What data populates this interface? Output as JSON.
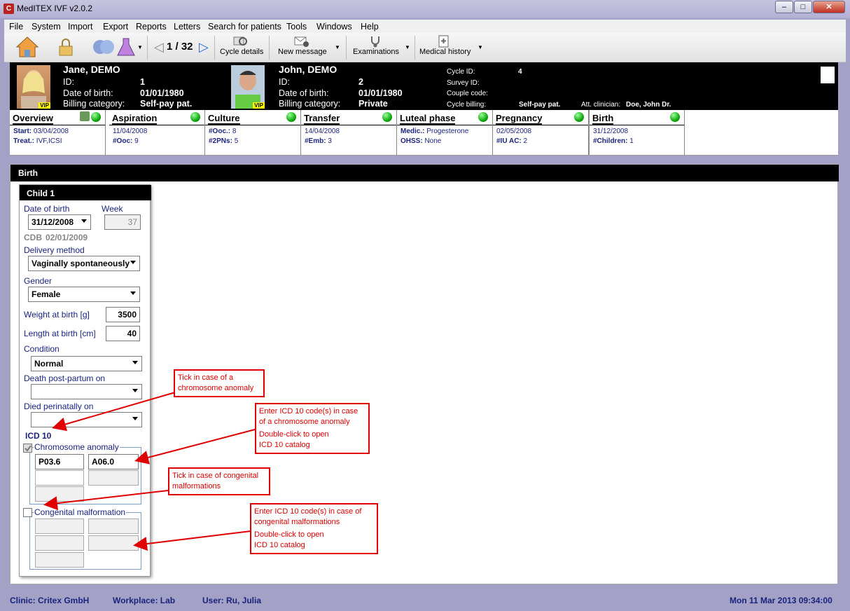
{
  "window": {
    "title": "MedITEX IVF v2.0.2",
    "app_icon": "C"
  },
  "menu": [
    "File",
    "System",
    "Import",
    "Export",
    "Reports",
    "Letters",
    "Search for patients",
    "Tools",
    "Windows",
    "Help"
  ],
  "toolbar": {
    "page": "1 / 32",
    "cycle_details": "Cycle details",
    "new_message": "New message",
    "examinations": "Examinations",
    "medical_history": "Medical history"
  },
  "patient": {
    "female": {
      "name": "Jane, DEMO",
      "id_label": "ID:",
      "id": "1",
      "dob_label": "Date of birth:",
      "dob": "01/01/1980",
      "billing_label": "Billing category:",
      "billing": "Self-pay pat.",
      "badge": "VIP"
    },
    "male": {
      "name": "John, DEMO",
      "id_label": "ID:",
      "id": "2",
      "dob_label": "Date of birth:",
      "dob": "01/01/1980",
      "billing_label": "Billing category:",
      "billing": "Private",
      "badge": "VIP"
    },
    "cycle": {
      "cycle_id_label": "Cycle ID:",
      "cycle_id": "4",
      "survey_label": "Survey ID:",
      "couple_label": "Couple code:",
      "billing_label": "Cycle billing:",
      "billing": "Self-pay pat.",
      "clinician_label": "Att. clinician:",
      "clinician": "Doe, John Dr."
    }
  },
  "tabs": [
    {
      "title": "Overview",
      "l1": "Start:",
      "v1": "03/04/2008",
      "l2": "Treat.:",
      "v2": "IVF,ICSI"
    },
    {
      "title": "Aspiration",
      "l1": "",
      "v1": "11/04/2008",
      "l2": "#Ooc:",
      "v2": "9"
    },
    {
      "title": "Culture",
      "l1": "#Ooc.:",
      "v1": "8",
      "l2": "#2PNs:",
      "v2": "5"
    },
    {
      "title": "Transfer",
      "l1": "",
      "v1": "14/04/2008",
      "l2": "#Emb:",
      "v2": "3"
    },
    {
      "title": "Luteal phase",
      "l1": "Medic.:",
      "v1": "Progesterone",
      "l2": "OHSS:",
      "v2": "None"
    },
    {
      "title": "Pregnancy",
      "l1": "",
      "v1": "02/05/2008",
      "l2": "#IU AC:",
      "v2": "2"
    },
    {
      "title": "Birth",
      "l1": "",
      "v1": "31/12/2008",
      "l2": "#Children:",
      "v2": "1"
    }
  ],
  "birth": {
    "section": "Birth",
    "child_title": "Child 1",
    "dob_label": "Date of birth",
    "dob": "31/12/2008",
    "week_label": "Week",
    "week": "37",
    "cdb_label": "CDB",
    "cdb": "02/01/2009",
    "delivery_label": "Delivery method",
    "delivery": "Vaginally spontaneously",
    "gender_label": "Gender",
    "gender": "Female",
    "weight_label": "Weight at birth [g]",
    "weight": "3500",
    "length_label": "Length at birth [cm]",
    "length": "40",
    "condition_label": "Condition",
    "condition": "Normal",
    "death_label": "Death post-partum on",
    "died_label": "Died perinatally on",
    "icd_label": "ICD 10",
    "chromo_label": "Chromosome anomaly",
    "code1": "P03.6",
    "code2": "A06.0",
    "congenital_label": "Congenital malformation"
  },
  "annotations": {
    "a1": [
      "Tick in case of a",
      "chromosome anomaly"
    ],
    "a2": [
      "Enter ICD 10 code(s) in case",
      "of a chromosome anomaly",
      "Double-click to open",
      "ICD 10 catalog"
    ],
    "a3": [
      "Tick in case of congenital",
      "malformations"
    ],
    "a4": [
      "Enter ICD 10 code(s) in case of",
      "congenital malformations",
      "Double-click to open",
      "ICD 10 catalog"
    ]
  },
  "status": {
    "clinic": "Clinic: Critex GmbH",
    "workplace": "Workplace: Lab",
    "user": "User: Ru, Julia",
    "datetime": "Mon 11 Mar 2013 09:34:00"
  },
  "colors": {
    "annotation": "#e00000",
    "label_blue": "#1a237e",
    "tab_dot": "#22aa22"
  }
}
